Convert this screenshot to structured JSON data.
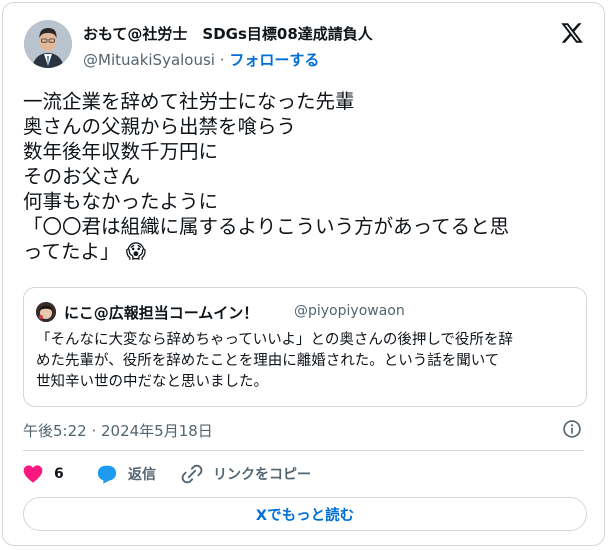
{
  "author": {
    "name": "おもて@社労士　SDGs目標08達成請負人",
    "handle": "@MituakiSyalousi",
    "separator": "·",
    "follow_label": "フォローする"
  },
  "tweet": {
    "lines": [
      "一流企業を辞めて社労士になった先輩",
      "奥さんの父親から出禁を喰らう",
      "数年後年収数千万円に",
      "そのお父さん",
      "何事もなかったように",
      "「〇〇君は組織に属するよりこういう方があってると思",
      "ってたよ」"
    ],
    "emoji": "😱"
  },
  "quote": {
    "name": "にこ@広報担当コームイン！",
    "handle": "@piyopiyowaon",
    "lines": [
      "「そんなに大変なら辞めちゃっていいよ」との奥さんの後押しで役所を辞",
      "めた先輩が、役所を辞めたことを理由に離婚された。という話を聞いて",
      "世知辛い世の中だなと思いました。"
    ]
  },
  "timestamp": "午後5:22 · 2024年5月18日",
  "actions": {
    "like_count": "6",
    "reply_label": "返信",
    "copy_link_label": "リンクをコピー"
  },
  "read_more_label": "Xでもっと読む",
  "colors": {
    "accent": "#006fd6",
    "like": "#f91880",
    "reply": "#1d9bf0",
    "muted": "#536471",
    "border": "#cfd9de"
  },
  "icons": [
    "x-logo-icon",
    "info-icon",
    "heart-icon",
    "reply-icon",
    "link-icon"
  ]
}
